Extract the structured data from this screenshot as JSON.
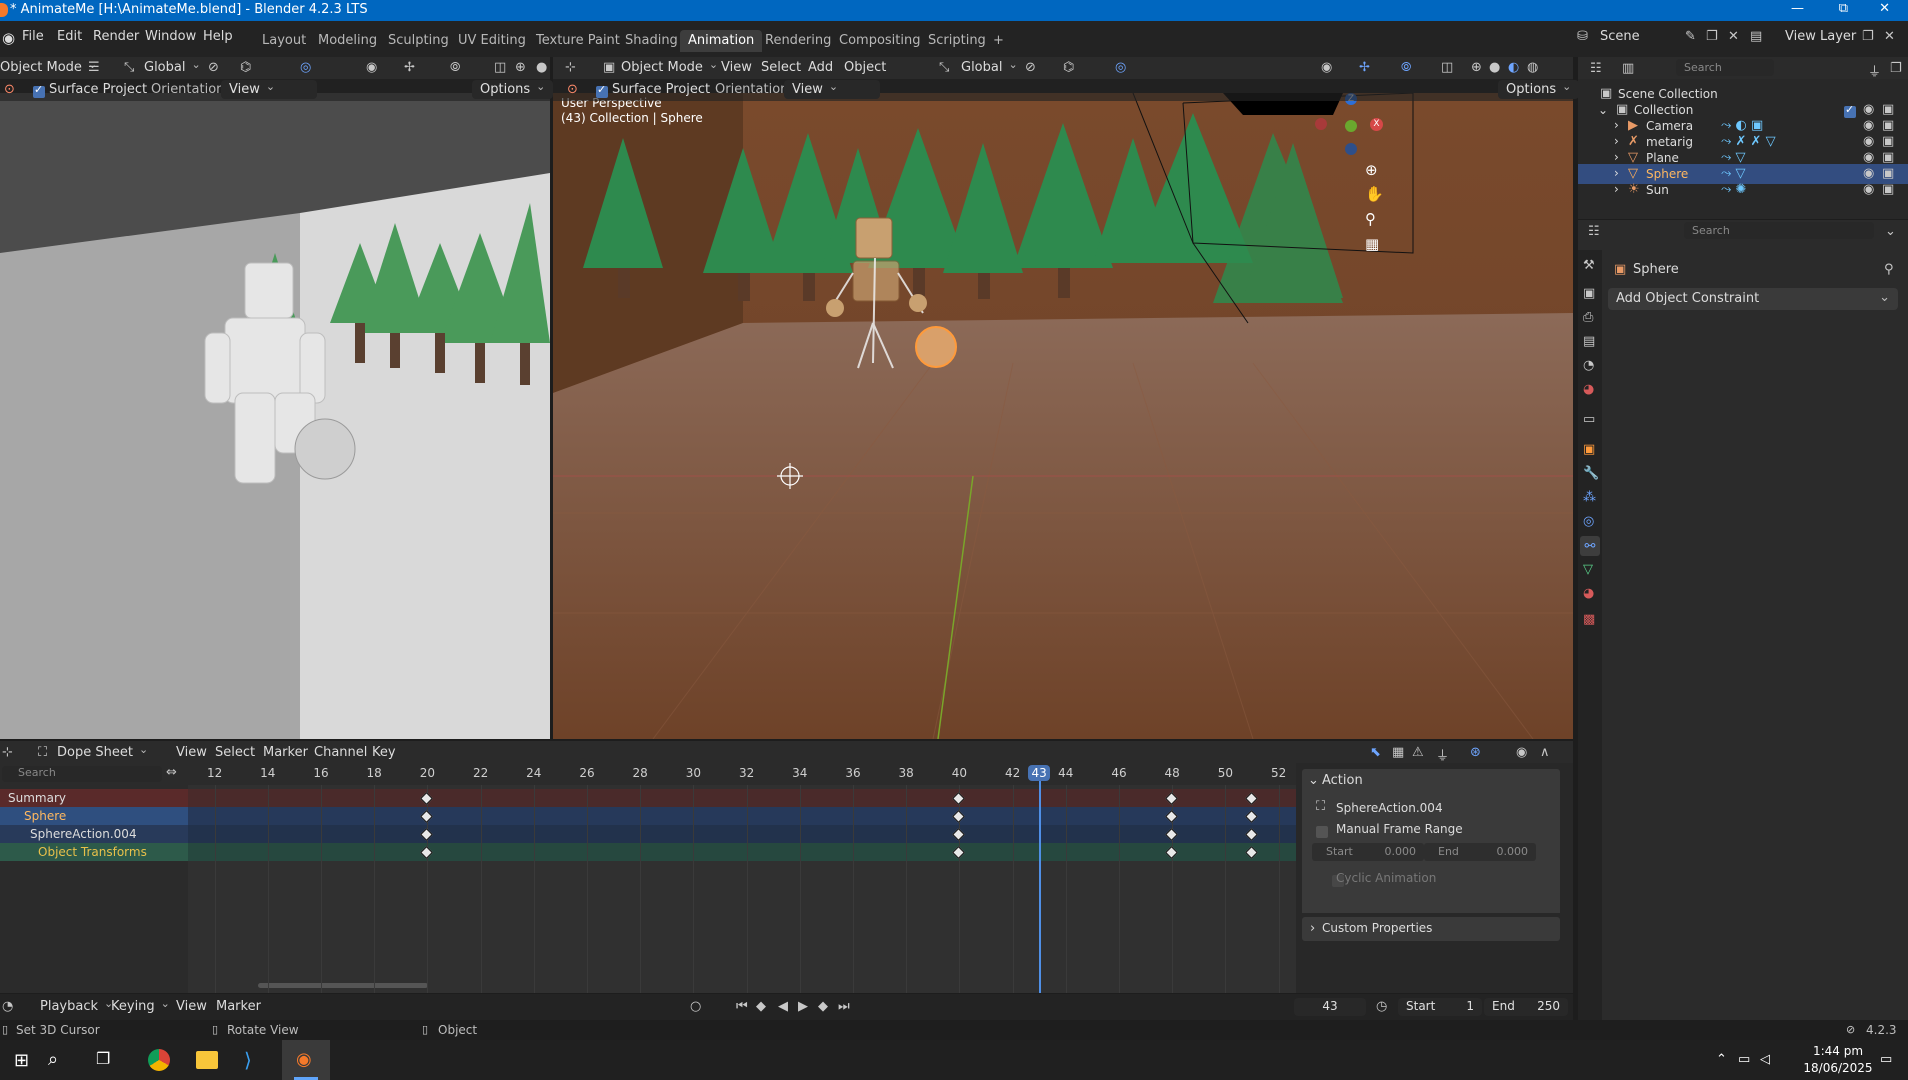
{
  "titlebar": {
    "title": "* AnimateMe [H:\\AnimateMe.blend] - Blender 4.2.3 LTS",
    "minimize": "—",
    "maximize": "⧉",
    "close": "✕"
  },
  "menu": [
    "File",
    "Edit",
    "Render",
    "Window",
    "Help"
  ],
  "workspaces": [
    "Layout",
    "Modeling",
    "Sculpting",
    "UV Editing",
    "Texture Paint",
    "Shading",
    "Animation",
    "Rendering",
    "Compositing",
    "Scripting",
    "+"
  ],
  "active_workspace": "Animation",
  "scene": {
    "name": "Scene",
    "view_layer": "View Layer"
  },
  "left_view": {
    "mode": "Object Mode",
    "transform": "Global",
    "surface_project": "Surface Project",
    "orientation_label": "Orientation:",
    "orientation": "View",
    "options": "Options"
  },
  "main_view": {
    "mode": "Object Mode",
    "menus": [
      "View",
      "Select",
      "Add",
      "Object"
    ],
    "transform": "Global",
    "surface_project": "Surface Project",
    "orientation_label": "Orientation:",
    "orientation": "View",
    "options": "Options",
    "overlay_line1": "User Perspective",
    "overlay_line2": "(43) Collection | Sphere",
    "gizmo": {
      "x": "X",
      "y": "Y",
      "z": "Z"
    }
  },
  "outliner": {
    "search_placeholder": "Search",
    "items": [
      {
        "label": "Scene Collection"
      },
      {
        "label": "Collection"
      },
      {
        "label": "Camera"
      },
      {
        "label": "metarig"
      },
      {
        "label": "Plane"
      },
      {
        "label": "Sphere"
      },
      {
        "label": "Sun"
      }
    ]
  },
  "properties": {
    "search_placeholder": "Search",
    "object": "Sphere",
    "add_constraint": "Add Object Constraint"
  },
  "dope_sheet": {
    "editor": "Dope Sheet",
    "menus": [
      "View",
      "Select",
      "Marker",
      "Channel",
      "Key"
    ],
    "search_placeholder": "Search",
    "frame_ticks": [
      "12",
      "14",
      "16",
      "18",
      "20",
      "22",
      "24",
      "26",
      "28",
      "30",
      "32",
      "34",
      "36",
      "38",
      "40",
      "42",
      "43",
      "44",
      "46",
      "48",
      "50",
      "52"
    ],
    "current_frame": "43",
    "channels": [
      "Summary",
      "Sphere",
      "SphereAction.004",
      "Object Transforms"
    ],
    "keyframes": [
      20,
      40,
      48,
      51
    ],
    "action_panel": {
      "title": "Action",
      "action_name": "SphereAction.004",
      "manual_range": "Manual Frame Range",
      "start_label": "Start",
      "start_value": "0.000",
      "end_label": "End",
      "end_value": "0.000",
      "cyclic": "Cyclic Animation",
      "custom_props": "Custom Properties"
    }
  },
  "timeline": {
    "menus": [
      "Playback",
      "Keying",
      "View",
      "Marker"
    ],
    "frame": "43",
    "start_label": "Start",
    "start": "1",
    "end_label": "End",
    "end": "250"
  },
  "status": {
    "left": "Set 3D Cursor",
    "mid": "Rotate View",
    "right": "Object",
    "version": "4.2.3"
  },
  "taskbar": {
    "time": "1:44 pm",
    "date": "18/06/2025"
  }
}
